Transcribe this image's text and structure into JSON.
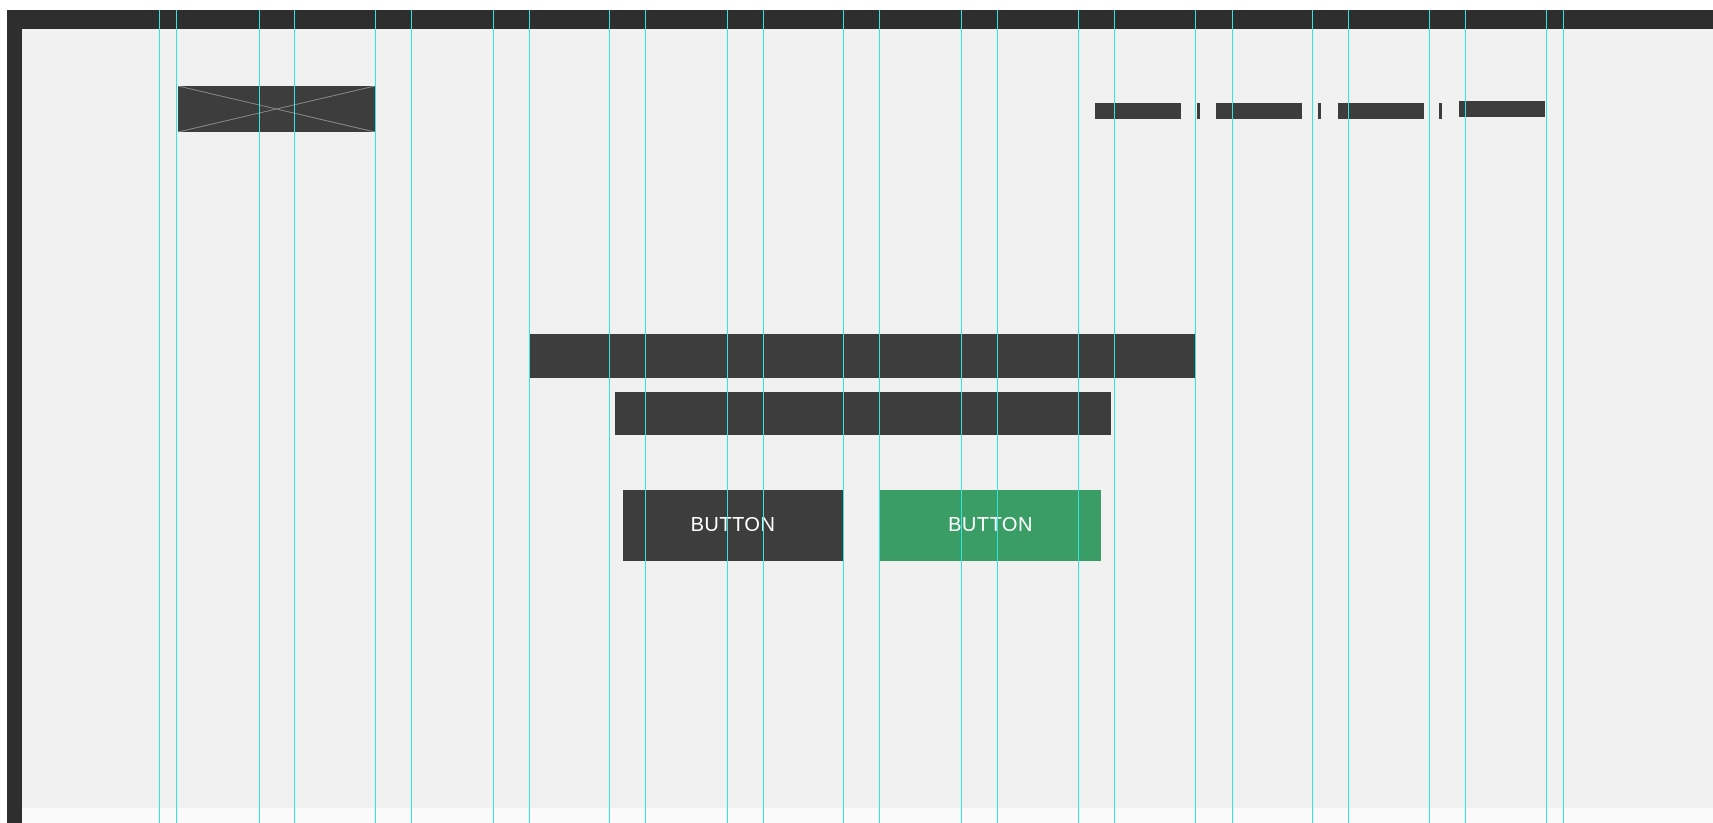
{
  "header": {
    "logo_icon": "image-placeholder-icon",
    "nav": [
      {
        "label": ""
      },
      {
        "label": ""
      },
      {
        "label": ""
      },
      {
        "label": ""
      }
    ]
  },
  "hero": {
    "headline": "",
    "subheadline": "",
    "primary_button_label": "BUTTON",
    "secondary_button_label": "BUTTON"
  },
  "colors": {
    "frame": "#2e2e2e",
    "canvas": "#f1f1f1",
    "placeholder": "#3d3d3d",
    "accent_green": "#3a9d66",
    "grid_guide": "#32e6e6"
  }
}
